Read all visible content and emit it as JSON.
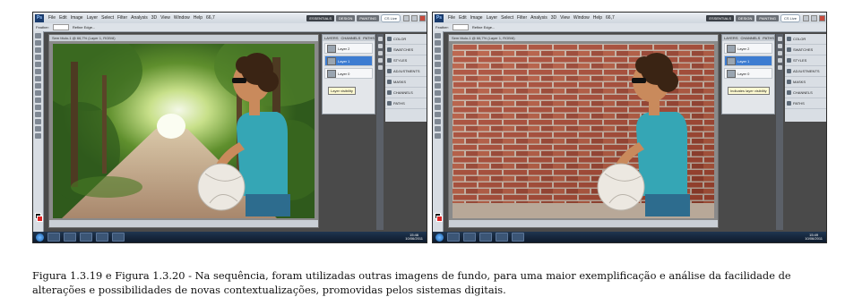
{
  "figures": [
    {
      "id": "left",
      "menubar": {
        "app_badge": "Ps",
        "menus": [
          "File",
          "Edit",
          "Image",
          "Layer",
          "Select",
          "Filter",
          "Analysis",
          "3D",
          "View",
          "Window",
          "Help"
        ],
        "zoom": "66,7",
        "workspaces": [
          "ESSENTIALS",
          "DESIGN",
          "PAINTING"
        ],
        "cs_live": "CS Live"
      },
      "options_bar": {
        "feather": "Feather:",
        "edge": "Refine Edge..."
      },
      "doc_tab": "Sem título-1 @ 66,7% (Layer 1, RGB/8)",
      "background": "forest path",
      "layers_panel": {
        "tabs": [
          "LAYERS",
          "CHANNELS",
          "PATHS"
        ],
        "rows": [
          "Layer 2",
          "Layer 1",
          "Layer 0"
        ],
        "selected_index": 1,
        "tooltip": "Layer visibility"
      },
      "panels": [
        "COLOR",
        "SWATCHES",
        "STYLES",
        "ADJUSTMENTS",
        "MASKS",
        "CHANNELS",
        "PATHS"
      ],
      "clock": {
        "time": "15:46",
        "date": "10/06/2011"
      }
    },
    {
      "id": "right",
      "menubar": {
        "app_badge": "Ps",
        "menus": [
          "File",
          "Edit",
          "Image",
          "Layer",
          "Select",
          "Filter",
          "Analysis",
          "3D",
          "View",
          "Window",
          "Help"
        ],
        "zoom": "66,7",
        "workspaces": [
          "ESSENTIALS",
          "DESIGN",
          "PAINTING"
        ],
        "cs_live": "CS Live"
      },
      "options_bar": {
        "feather": "Feather:",
        "edge": "Refine Edge..."
      },
      "doc_tab": "Sem título-1 @ 66,7% (Layer 1, RGB/8)",
      "background": "brick wall",
      "layers_panel": {
        "tabs": [
          "LAYERS",
          "CHANNELS",
          "PATHS"
        ],
        "rows": [
          "Layer 2",
          "Layer 1",
          "Layer 0"
        ],
        "selected_index": 1,
        "tooltip": "Indicates layer visibility"
      },
      "panels": [
        "COLOR",
        "SWATCHES",
        "STYLES",
        "ADJUSTMENTS",
        "MASKS",
        "CHANNELS",
        "PATHS"
      ],
      "clock": {
        "time": "15:49",
        "date": "10/06/2011"
      }
    }
  ],
  "colors": {
    "forest_dark": "#2f5a1c",
    "forest_light": "#8fbf4a",
    "path": "#b79a80",
    "brick": "#a8452f",
    "mortar": "#c9b5a6",
    "shirt": "#35a6b5",
    "skin": "#c98a5c",
    "hair": "#3a2414",
    "ball": "#ece8e1"
  },
  "caption": "Figura 1.3.19 e Figura 1.3.20 - Na sequência, foram utilizadas outras imagens de fundo, para uma maior exemplificação e análise da facilidade de alterações e possibilidades de novas contextualizações, promovidas pelos sistemas digitais."
}
